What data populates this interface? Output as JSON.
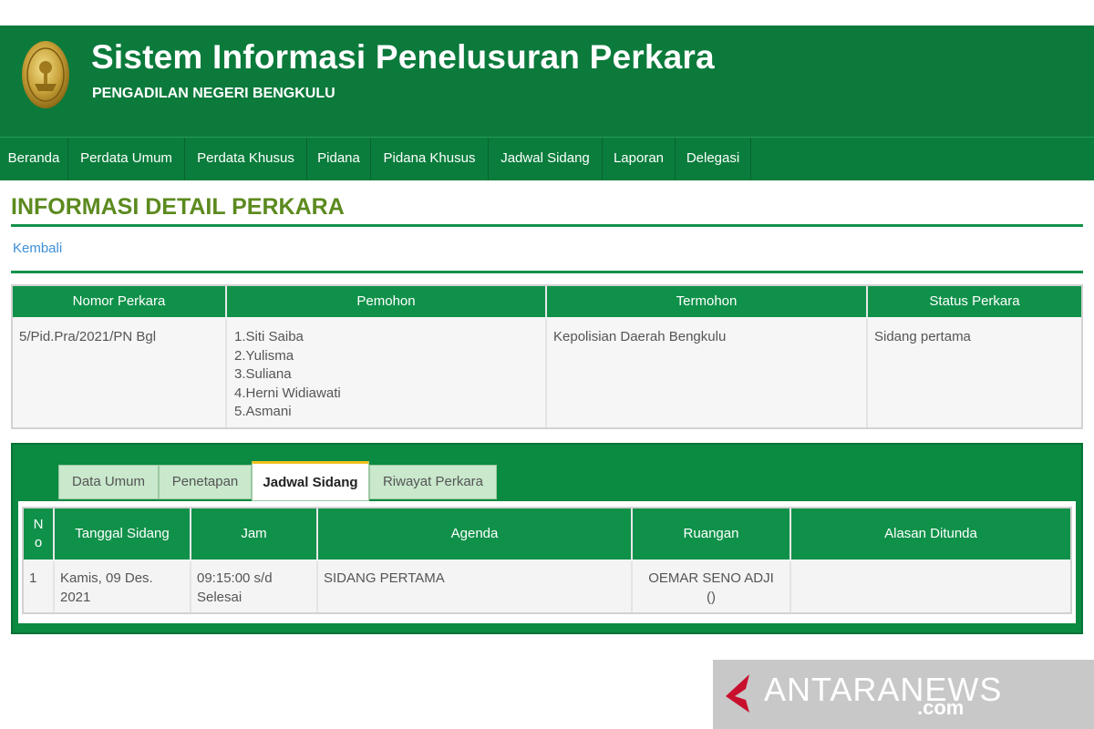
{
  "header": {
    "title": "Sistem Informasi Penelusuran Perkara",
    "subtitle": "PENGADILAN NEGERI BENGKULU",
    "logo_icon": "court-emblem-icon",
    "bg_color": "#0b7a3b"
  },
  "nav": {
    "items": [
      {
        "label": "Beranda"
      },
      {
        "label": "Perdata Umum"
      },
      {
        "label": "Perdata Khusus"
      },
      {
        "label": "Pidana"
      },
      {
        "label": "Pidana Khusus"
      },
      {
        "label": "Jadwal Sidang"
      },
      {
        "label": "Laporan"
      },
      {
        "label": "Delegasi"
      }
    ]
  },
  "page": {
    "heading": "INFORMASI DETAIL PERKARA",
    "back_link": "Kembali"
  },
  "case": {
    "headers": [
      "Nomor Perkara",
      "Pemohon",
      "Termohon",
      "Status Perkara"
    ],
    "nomor": "5/Pid.Pra/2021/PN Bgl",
    "pemohon": [
      "1.Siti Saiba",
      "2.Yulisma",
      "3.Suliana",
      "4.Herni Widiawati",
      "5.Asmani"
    ],
    "termohon": "Kepolisian Daerah Bengkulu",
    "status": "Sidang pertama"
  },
  "tabs": {
    "items": [
      {
        "label": "Data Umum",
        "active": false
      },
      {
        "label": "Penetapan",
        "active": false
      },
      {
        "label": "Jadwal Sidang",
        "active": true
      },
      {
        "label": "Riwayat Perkara",
        "active": false
      }
    ]
  },
  "schedule": {
    "headers": {
      "no_line1": "N",
      "no_line2": "o",
      "tanggal": "Tanggal Sidang",
      "jam": "Jam",
      "agenda": "Agenda",
      "ruangan": "Ruangan",
      "alasan": "Alasan Ditunda"
    },
    "rows": [
      {
        "no": "1",
        "tanggal_line1": "Kamis, 09 Des.",
        "tanggal_line2": "2021",
        "jam_line1": "09:15:00 s/d",
        "jam_line2": "Selesai",
        "agenda": "SIDANG PERTAMA",
        "ruangan_line1": "OEMAR SENO ADJI",
        "ruangan_line2": "()",
        "alasan": ""
      }
    ]
  },
  "watermark": {
    "brand": "ANTARANEWS",
    "suffix": ".com",
    "icon": "antara-logo-icon"
  }
}
